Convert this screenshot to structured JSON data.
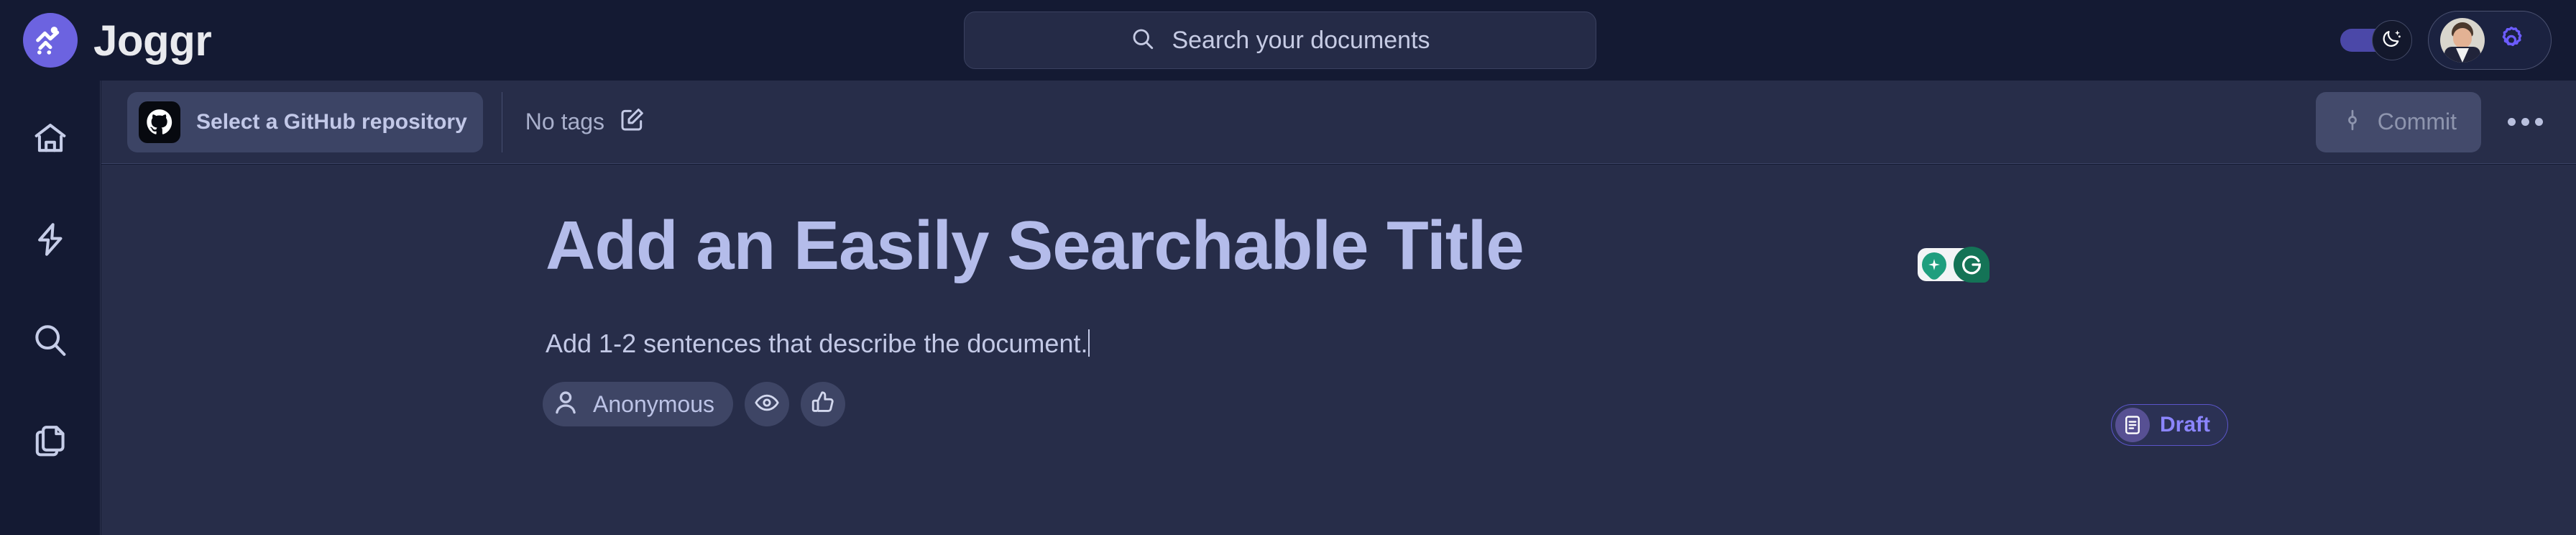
{
  "app": {
    "brand_name": "Joggr",
    "brand_icon": "joggr-runner-logo",
    "accent_color": "#6c63e0",
    "topbar_bg": "#141a33",
    "content_bg": "#272d49"
  },
  "search": {
    "placeholder": "Search your documents",
    "icon": "search-icon"
  },
  "topbar_right": {
    "dark_mode_toggle": {
      "icon": "moon-stars-icon",
      "state": "on"
    },
    "avatar": {
      "icon": "user-avatar-photo"
    },
    "settings": {
      "icon": "gear-icon",
      "color": "#6c5cff"
    }
  },
  "sidebar": {
    "items": [
      {
        "name": "home",
        "icon": "home-icon"
      },
      {
        "name": "quick-actions",
        "icon": "lightning-bolt-icon"
      },
      {
        "name": "search",
        "icon": "search-icon"
      },
      {
        "name": "documents",
        "icon": "documents-copy-icon"
      }
    ]
  },
  "toolbar": {
    "repo_label": "Select a GitHub repository",
    "repo_icon": "github-icon",
    "tags_label": "No tags",
    "tags_edit_icon": "edit-pencil-icon",
    "commit_label": "Commit",
    "commit_icon": "git-commit-icon",
    "commit_disabled": true,
    "more_icon": "more-horizontal-icon"
  },
  "document": {
    "title": "Add an Easily Searchable Title",
    "subtitle": "Add 1-2 sentences that describe the document.",
    "author": "Anonymous",
    "author_icon": "user-icon",
    "views_icon": "eye-icon",
    "likes_icon": "thumbs-up-icon",
    "status_badge": {
      "label": "Draft",
      "icon": "document-icon",
      "color": "#8b85ff"
    }
  },
  "extension": {
    "name": "grammarly-widget",
    "icons": [
      "grammarly-spark-icon",
      "grammarly-g-icon"
    ]
  }
}
